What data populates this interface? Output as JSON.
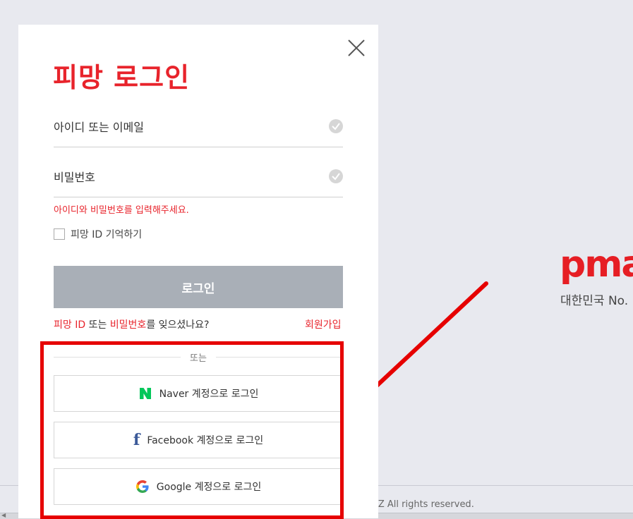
{
  "background": {
    "brand_logo": "pma",
    "brand_tagline": "대한민국 No.",
    "footer_text": "IZ All rights reserved."
  },
  "login": {
    "title": "피망 로그인",
    "id_placeholder": "아이디 또는 이메일",
    "password_placeholder": "비밀번호",
    "error_message": "아이디와 비밀번호를 입력해주세요.",
    "remember_label": "피망 ID 기억하기",
    "login_button": "로그인",
    "forgot": {
      "part1": "피망 ID",
      "part2": " 또는 ",
      "part3": "비밀번호",
      "part4": "를 잊으셨나요?"
    },
    "signup_link": "회원가입",
    "divider_text": "또는",
    "social": [
      {
        "icon": "naver-icon",
        "label": "Naver 계정으로 로그인"
      },
      {
        "icon": "facebook-icon",
        "label": "Facebook 계정으로 로그인"
      },
      {
        "icon": "google-icon",
        "label": "Google 계정으로 로그인"
      }
    ]
  },
  "colors": {
    "accent_red": "#e8232b",
    "login_button_gray": "#a9afb7",
    "annotation_red": "#e60000",
    "naver_green": "#03c75a",
    "facebook_blue": "#3b5998"
  }
}
